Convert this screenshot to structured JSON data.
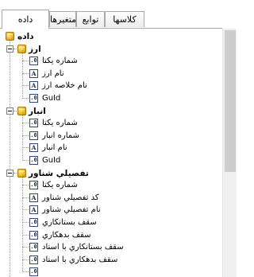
{
  "tabs": [
    {
      "label": "داده",
      "active": true
    },
    {
      "label": "متغيرها",
      "active": false
    },
    {
      "label": "توابع",
      "active": false
    },
    {
      "label": "كلاسها",
      "active": false
    }
  ],
  "tree": {
    "root": {
      "label": "داده",
      "icon": "table-icon"
    },
    "groups": [
      {
        "label": "ارز",
        "items": [
          {
            "icon": "numeric-field-icon",
            "glyph": ".0",
            "label": "شماره يكتا"
          },
          {
            "icon": "text-field-icon",
            "glyph": "A",
            "label": "نام ارز"
          },
          {
            "icon": "text-field-icon",
            "glyph": "A",
            "label": "نام خلاصه ارز"
          },
          {
            "icon": "numeric-field-icon",
            "glyph": ".0",
            "label": "GuId"
          }
        ]
      },
      {
        "label": "انبار",
        "items": [
          {
            "icon": "numeric-field-icon",
            "glyph": ".0",
            "label": "شماره يكتا"
          },
          {
            "icon": "numeric-field-icon",
            "glyph": ".0",
            "label": "شماره انبار"
          },
          {
            "icon": "text-field-icon",
            "glyph": "A",
            "label": "نام انبار"
          },
          {
            "icon": "numeric-field-icon",
            "glyph": ".0",
            "label": "GuId"
          }
        ]
      },
      {
        "label": "تفصيلي شناور",
        "items": [
          {
            "icon": "numeric-field-icon",
            "glyph": ".0",
            "label": "شماره يكتا"
          },
          {
            "icon": "text-field-icon",
            "glyph": "A",
            "label": "كد تفصيلي شناور"
          },
          {
            "icon": "text-field-icon",
            "glyph": "A",
            "label": "نام تفصيلي شناور"
          },
          {
            "icon": "numeric-field-icon",
            "glyph": ".0",
            "label": "سقف بستانكاري"
          },
          {
            "icon": "numeric-field-icon",
            "glyph": ".0",
            "label": "سقف بدهكاري"
          },
          {
            "icon": "numeric-field-icon",
            "glyph": ".0",
            "label": "سقف بستانكاري با اسناد"
          },
          {
            "icon": "numeric-field-icon",
            "glyph": ".0",
            "label": "سقف بدهكاري با اسناد"
          },
          {
            "icon": "numeric-field-icon",
            "glyph": ".0",
            "label": ""
          }
        ]
      }
    ]
  }
}
